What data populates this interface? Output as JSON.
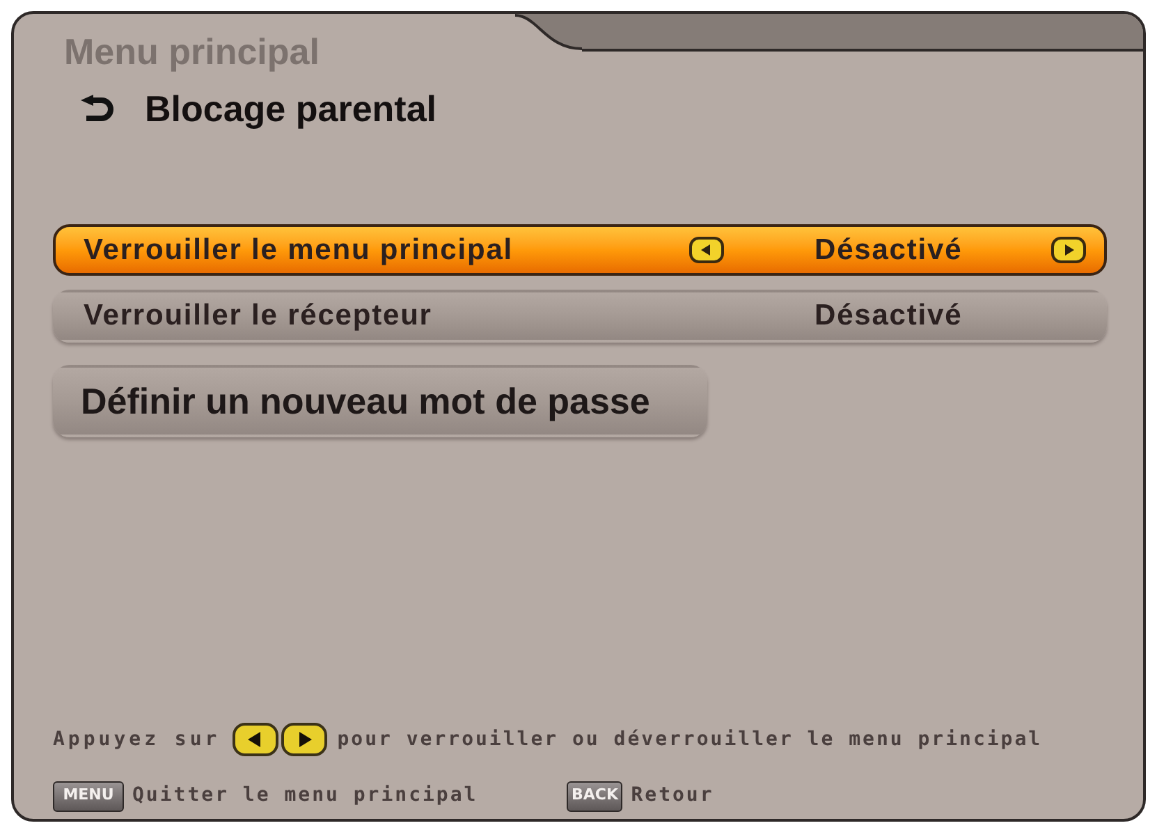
{
  "breadcrumb": {
    "parent": "Menu principal",
    "current": "Blocage parental"
  },
  "options": [
    {
      "kind": "toggle",
      "label": "Verrouiller le menu principal",
      "value": "Désactivé",
      "selected": true
    },
    {
      "kind": "toggle",
      "label": "Verrouiller le récepteur",
      "value": "Désactivé",
      "selected": false
    },
    {
      "kind": "action",
      "label": "Définir un nouveau mot de passe",
      "selected": false
    }
  ],
  "hint": {
    "before": "Appuyez sur",
    "after": "pour verrouiller ou déverrouiller le menu principal"
  },
  "footer_keys": [
    {
      "key": "MENU",
      "label": "Quitter le menu principal"
    },
    {
      "key": "BACK",
      "label": "Retour"
    }
  ]
}
